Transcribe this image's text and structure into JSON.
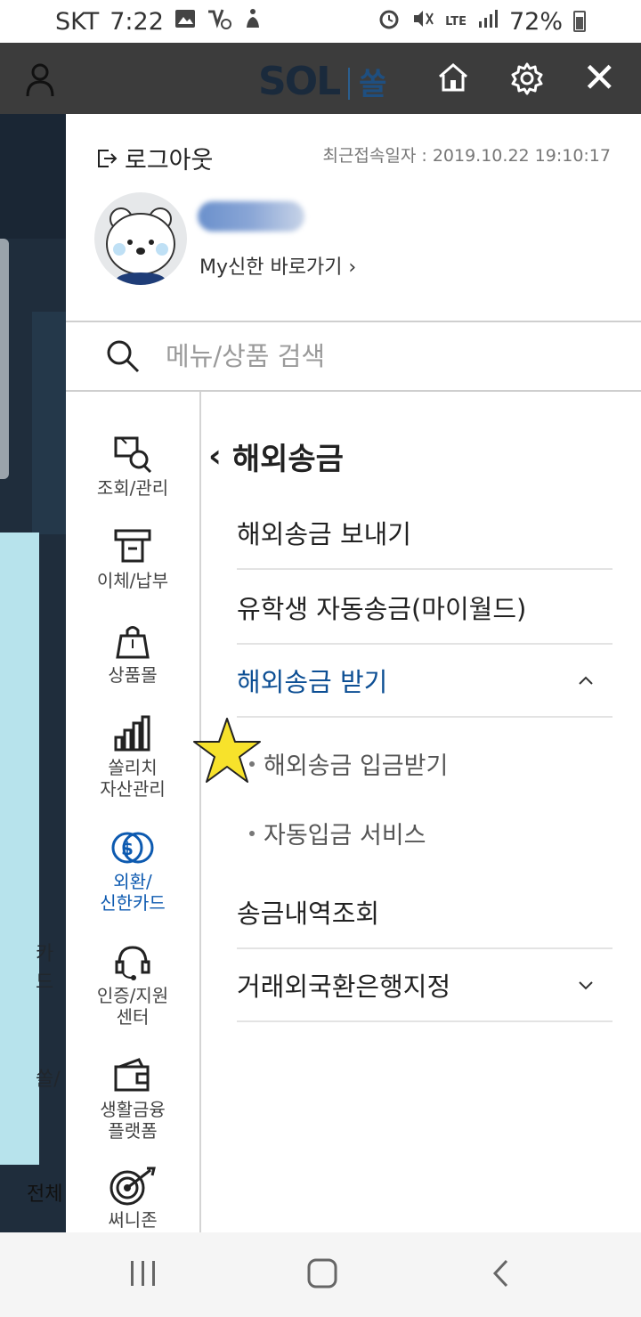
{
  "status": {
    "carrier": "SKT",
    "time": "7:22",
    "network": "LTE",
    "battery": "72%"
  },
  "appbar": {
    "logo_text": "SOL",
    "logo_kr": "쏠",
    "close_glyph": "✕"
  },
  "drawer": {
    "logout_label": "로그아웃",
    "last_login": "최근접속일자 : 2019.10.22 19:10:17",
    "my_link": "My신한 바로가기 ›",
    "search_placeholder": "메뉴/상품 검색"
  },
  "categories": [
    {
      "label": "조회/관리",
      "icon": "inquiry-icon"
    },
    {
      "label": "이체/납부",
      "icon": "transfer-icon"
    },
    {
      "label": "상품몰",
      "icon": "shopping-bag-icon"
    },
    {
      "label": "쏠리치",
      "label2": "자산관리",
      "icon": "bar-chart-icon"
    },
    {
      "label": "외환/",
      "label2": "신한카드",
      "icon": "exchange-icon",
      "active": true
    },
    {
      "label": "인증/지원",
      "label2": "센터",
      "icon": "headset-icon"
    },
    {
      "label": "생활금융",
      "label2": "플랫폼",
      "icon": "wallet-icon"
    },
    {
      "label": "써니존",
      "icon": "target-icon"
    }
  ],
  "content": {
    "back_glyph": "‹",
    "section_title": "해외송금",
    "items": [
      {
        "label": "해외송금 보내기"
      },
      {
        "label": "유학생 자동송금(마이월드)"
      },
      {
        "label": "해외송금 받기",
        "active": true,
        "expanded": true
      },
      {
        "label": "송금내역조회"
      },
      {
        "label": "거래외국환은행지정"
      }
    ],
    "subitems": [
      {
        "label": "해외송금 입금받기"
      },
      {
        "label": "자동입금 서비스"
      }
    ]
  },
  "background": {
    "text1": "카드",
    "text2": "쏠/",
    "text3": "전체"
  },
  "colors": {
    "accent_blue": "#0d5ab0",
    "star_yellow": "#f7e22b"
  }
}
